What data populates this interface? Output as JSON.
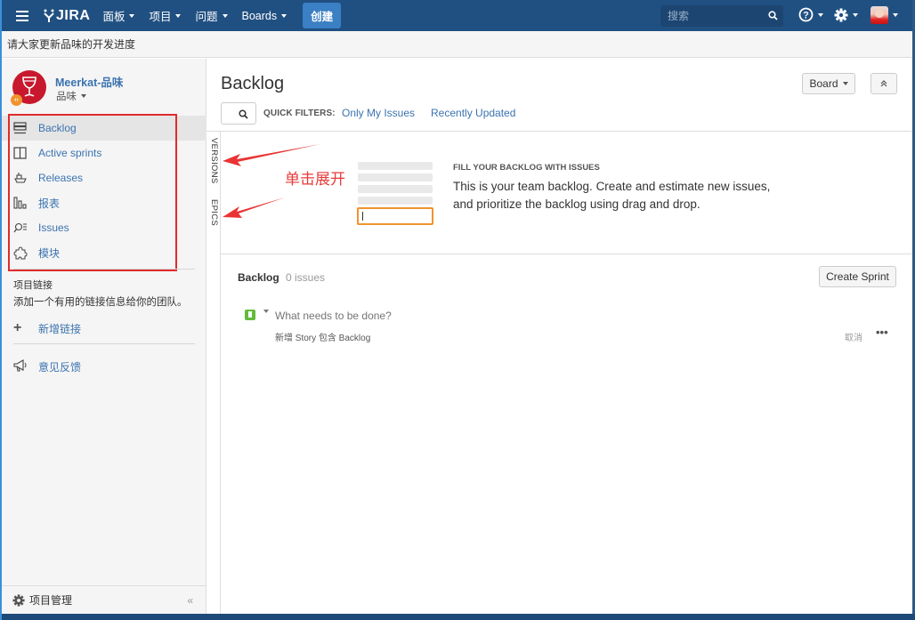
{
  "topnav": {
    "logo_text": "JIRA",
    "menus": [
      {
        "label": "面板"
      },
      {
        "label": "项目"
      },
      {
        "label": "问题"
      },
      {
        "label": "Boards"
      }
    ],
    "create_label": "创建",
    "search_placeholder": "搜索"
  },
  "announcement": "请大家更新品味的开发进度",
  "sidebar": {
    "project_name": "Meerkat-品味",
    "project_type": "品味",
    "items": [
      {
        "label": "Backlog",
        "icon": "backlog-icon",
        "active": true
      },
      {
        "label": "Active sprints",
        "icon": "active-sprints-icon"
      },
      {
        "label": "Releases",
        "icon": "releases-icon"
      },
      {
        "label": "报表",
        "icon": "reports-icon"
      },
      {
        "label": "Issues",
        "icon": "issues-icon"
      },
      {
        "label": "模块",
        "icon": "components-icon"
      }
    ],
    "links_title": "项目链接",
    "links_desc": "添加一个有用的链接信息给你的团队。",
    "add_link": "新增链接",
    "feedback": "意见反馈",
    "footer": "项目管理",
    "collapse": "«"
  },
  "main": {
    "title": "Backlog",
    "board_button": "Board",
    "quick_filters_label": "QUICK FILTERS:",
    "quick_filters": [
      "Only My Issues",
      "Recently Updated"
    ],
    "side_tabs": [
      "VERSIONS",
      "EPICS"
    ],
    "annotation": "单击展开",
    "empty_title": "FILL YOUR BACKLOG WITH ISSUES",
    "empty_desc": "This is your team backlog. Create and estimate new issues, and prioritize the backlog using drag and drop.",
    "backlog_label": "Backlog",
    "backlog_count": "0 issues",
    "create_sprint": "Create Sprint",
    "new_issue_placeholder": "What needs to be done?",
    "new_issue_hint": "新增 Story 包含 Backlog",
    "cancel": "取消",
    "more": "•••"
  },
  "colors": {
    "nav_bg": "#205081",
    "link": "#3b73af",
    "create_btn": "#3b7fc4",
    "highlight_box": "#e02b2b",
    "story_green": "#63ba3c",
    "project_avatar": "#c8182d"
  }
}
